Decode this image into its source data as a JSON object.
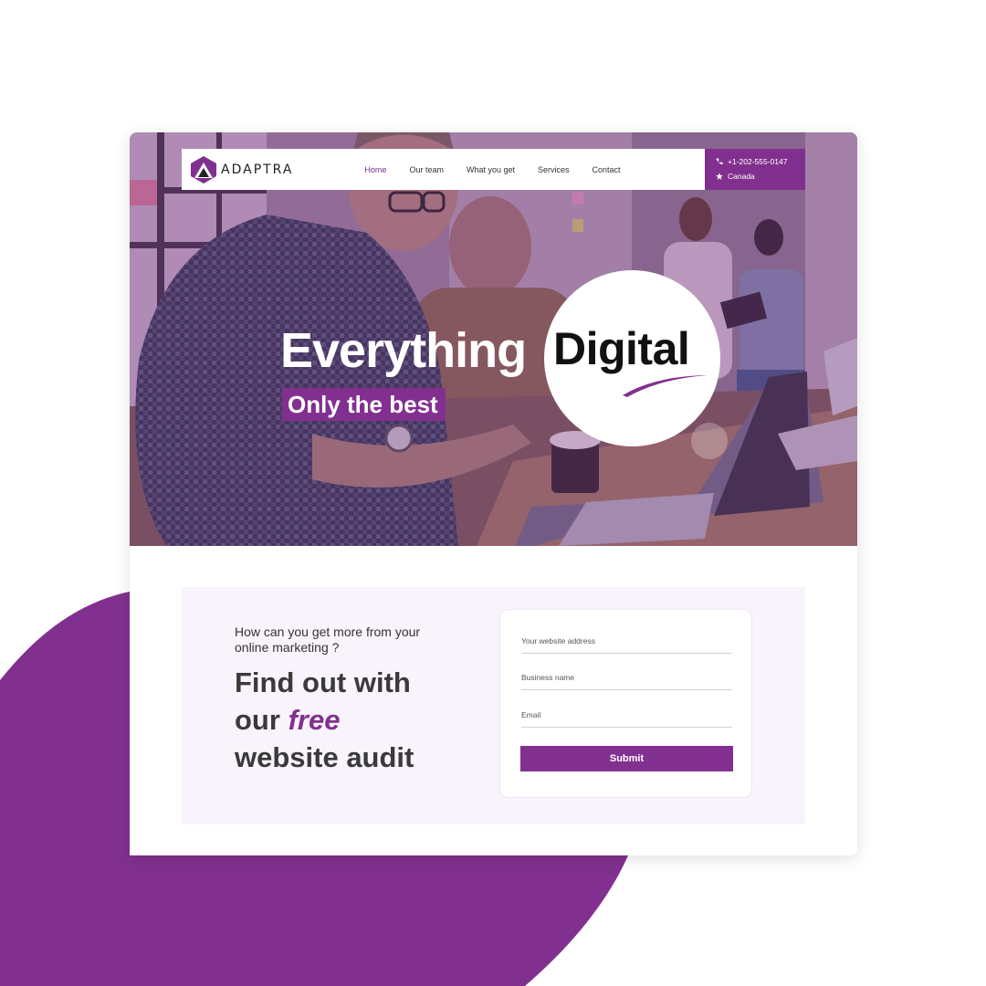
{
  "brand": {
    "name": "ADAPTRA",
    "color": "#82308f"
  },
  "nav": {
    "items": [
      {
        "label": "Home",
        "active": true
      },
      {
        "label": "Our team",
        "active": false
      },
      {
        "label": "What you get",
        "active": false
      },
      {
        "label": "Services",
        "active": false
      },
      {
        "label": "Contact",
        "active": false
      }
    ]
  },
  "contact": {
    "phone": "+1-202-555-0147",
    "location": "Canada",
    "phone_icon": "phone-icon",
    "location_icon": "pin-icon"
  },
  "hero": {
    "headline": "Everything",
    "highlight": "Digital",
    "tagline": "Only the best"
  },
  "audit": {
    "question": "How can you get more from your online marketing ?",
    "heading_line1": "Find out with",
    "heading_line2_prefix": "our",
    "heading_emphasis": "free",
    "heading_line3": "website audit"
  },
  "form": {
    "website_placeholder": "Your website address",
    "business_placeholder": "Business name",
    "email_placeholder": "Email",
    "submit_label": "Submit"
  }
}
